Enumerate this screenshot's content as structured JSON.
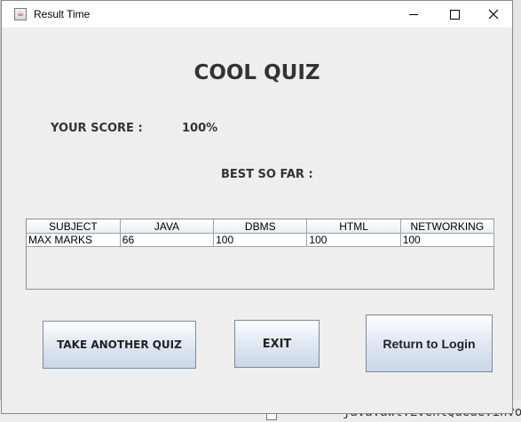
{
  "window": {
    "title": "Result Time",
    "icon": "java-icon"
  },
  "quiz": {
    "title": "COOL QUIZ",
    "score_label": "YOUR SCORE :",
    "score_value": "100%",
    "best_label": "BEST SO FAR :"
  },
  "table": {
    "headers": [
      "SUBJECT",
      "JAVA",
      "DBMS",
      "HTML",
      "NETWORKING"
    ],
    "rows": [
      [
        "MAX MARKS",
        "66",
        "100",
        "100",
        "100"
      ]
    ]
  },
  "buttons": {
    "take_another": "TAKE ANOTHER QUIZ",
    "exit": "EXIT",
    "return_login": "Return to Login"
  },
  "background": {
    "code_fragment": "java.awt.EventQueue.invok"
  }
}
